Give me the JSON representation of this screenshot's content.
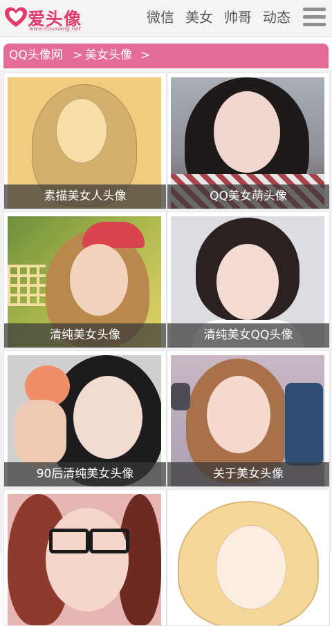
{
  "header": {
    "logo_text": "爱头像",
    "logo_url": "www.itouxiang.net",
    "nav": [
      "微信",
      "美女",
      "帅哥",
      "动态"
    ],
    "menu_icon": "hamburger-menu-icon"
  },
  "breadcrumb": {
    "site": "QQ头像网",
    "separator": ">",
    "category": "美女头像",
    "trailing_separator": ">"
  },
  "tiles": [
    {
      "caption": "素描美女人头像"
    },
    {
      "caption": "QQ美女萌头像"
    },
    {
      "caption": "清纯美女头像"
    },
    {
      "caption": "清纯美女QQ头像"
    },
    {
      "caption": "90后清纯美女头像"
    },
    {
      "caption": "关于美女头像"
    },
    {
      "caption": ""
    },
    {
      "caption": ""
    }
  ],
  "colors": {
    "brand_pink": "#e33a6a",
    "breadcrumb_bg": "#e56b98",
    "header_bg": "#f4f4f4",
    "caption_bg": "rgba(55,55,55,0.72)"
  }
}
